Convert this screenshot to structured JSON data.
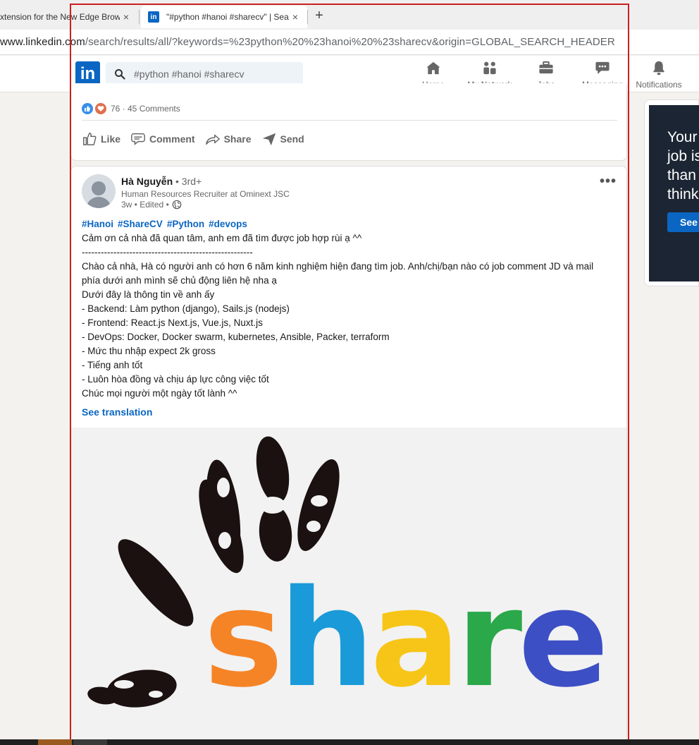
{
  "browser": {
    "tabs": [
      {
        "title": "xtension for the New Edge Brow",
        "close": "×"
      },
      {
        "title": "\"#python #hanoi #sharecv\" | Sea",
        "close": "×",
        "favicon": "in"
      }
    ],
    "new_tab": "+",
    "url_host": "www.linkedin.com",
    "url_path": "/search/results/all/?keywords=%23python%20%23hanoi%20%23sharecv&origin=GLOBAL_SEARCH_HEADER"
  },
  "header": {
    "logo": "in",
    "search_value": "#python #hanoi #sharecv",
    "nav": [
      {
        "label": "Home",
        "icon": "home-icon"
      },
      {
        "label": "My Network",
        "icon": "network-icon"
      },
      {
        "label": "Jobs",
        "icon": "jobs-icon"
      },
      {
        "label": "Messaging",
        "icon": "messaging-icon"
      },
      {
        "label": "Notifications",
        "icon": "bell-icon"
      }
    ]
  },
  "previous_post": {
    "social_counts": "76 · 45 Comments",
    "actions": {
      "like": "Like",
      "comment": "Comment",
      "share": "Share",
      "send": "Send"
    }
  },
  "post": {
    "author_name": "Hà Nguyễn",
    "author_degree": "• 3rd+",
    "author_title": "Human Resources Recruiter at Ominext JSC",
    "meta": "3w • Edited •",
    "more": "•••",
    "hashtags": [
      "#Hanoi",
      "#ShareCV",
      "#Python",
      "#devops"
    ],
    "lines": [
      "Cảm ơn cả nhà đã quan tâm, anh em đã tìm được job hợp rùi ạ ^^",
      "------------------------------------------------------",
      "Chào cả nhà, Hà có người anh có hơn 6 năm kinh nghiệm hiện đang tìm job. Anh/chị/bạn nào có job comment JD và mail",
      "phía dưới anh mình sẽ chủ động liên hệ nha ạ",
      "Dưới đây là thông tin về anh ấy",
      "- Backend: Làm python (django), Sails.js (nodejs)",
      "- Frontend: React.js Next.js, Vue.js, Nuxt.js",
      "- DevOps: Docker, Docker swarm, kubernetes, Ansible, Packer, terraform",
      "- Mức thu nhập expect 2k gross",
      "- Tiếng anh tốt",
      "- Luôn hòa đồng và chịu áp lực công việc tốt",
      "Chúc mọi người một ngày tốt lành ^^"
    ],
    "see_translation": "See translation",
    "image": {
      "letters": [
        {
          "char": "s",
          "color": "#f58426"
        },
        {
          "char": "h",
          "color": "#1a9ad9"
        },
        {
          "char": "a",
          "color": "#f7c518"
        },
        {
          "char": "r",
          "color": "#2aa84a"
        },
        {
          "char": "e",
          "color": "#3d4fc4"
        }
      ]
    }
  },
  "ad": {
    "lines": [
      "Your",
      "job is",
      "than",
      "think"
    ],
    "button": "See j"
  },
  "colors": {
    "brand": "#0a66c2",
    "selection_outline": "#cc1f1f"
  }
}
